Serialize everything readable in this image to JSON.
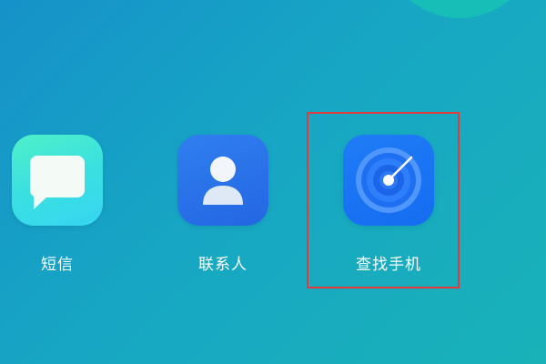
{
  "apps": [
    {
      "label": "短信",
      "icon": "message-bubble-icon"
    },
    {
      "label": "联系人",
      "icon": "person-icon"
    },
    {
      "label": "查找手机",
      "icon": "radar-icon"
    }
  ],
  "highlight": {
    "target": "查找手机",
    "color": "#e23b3b"
  }
}
